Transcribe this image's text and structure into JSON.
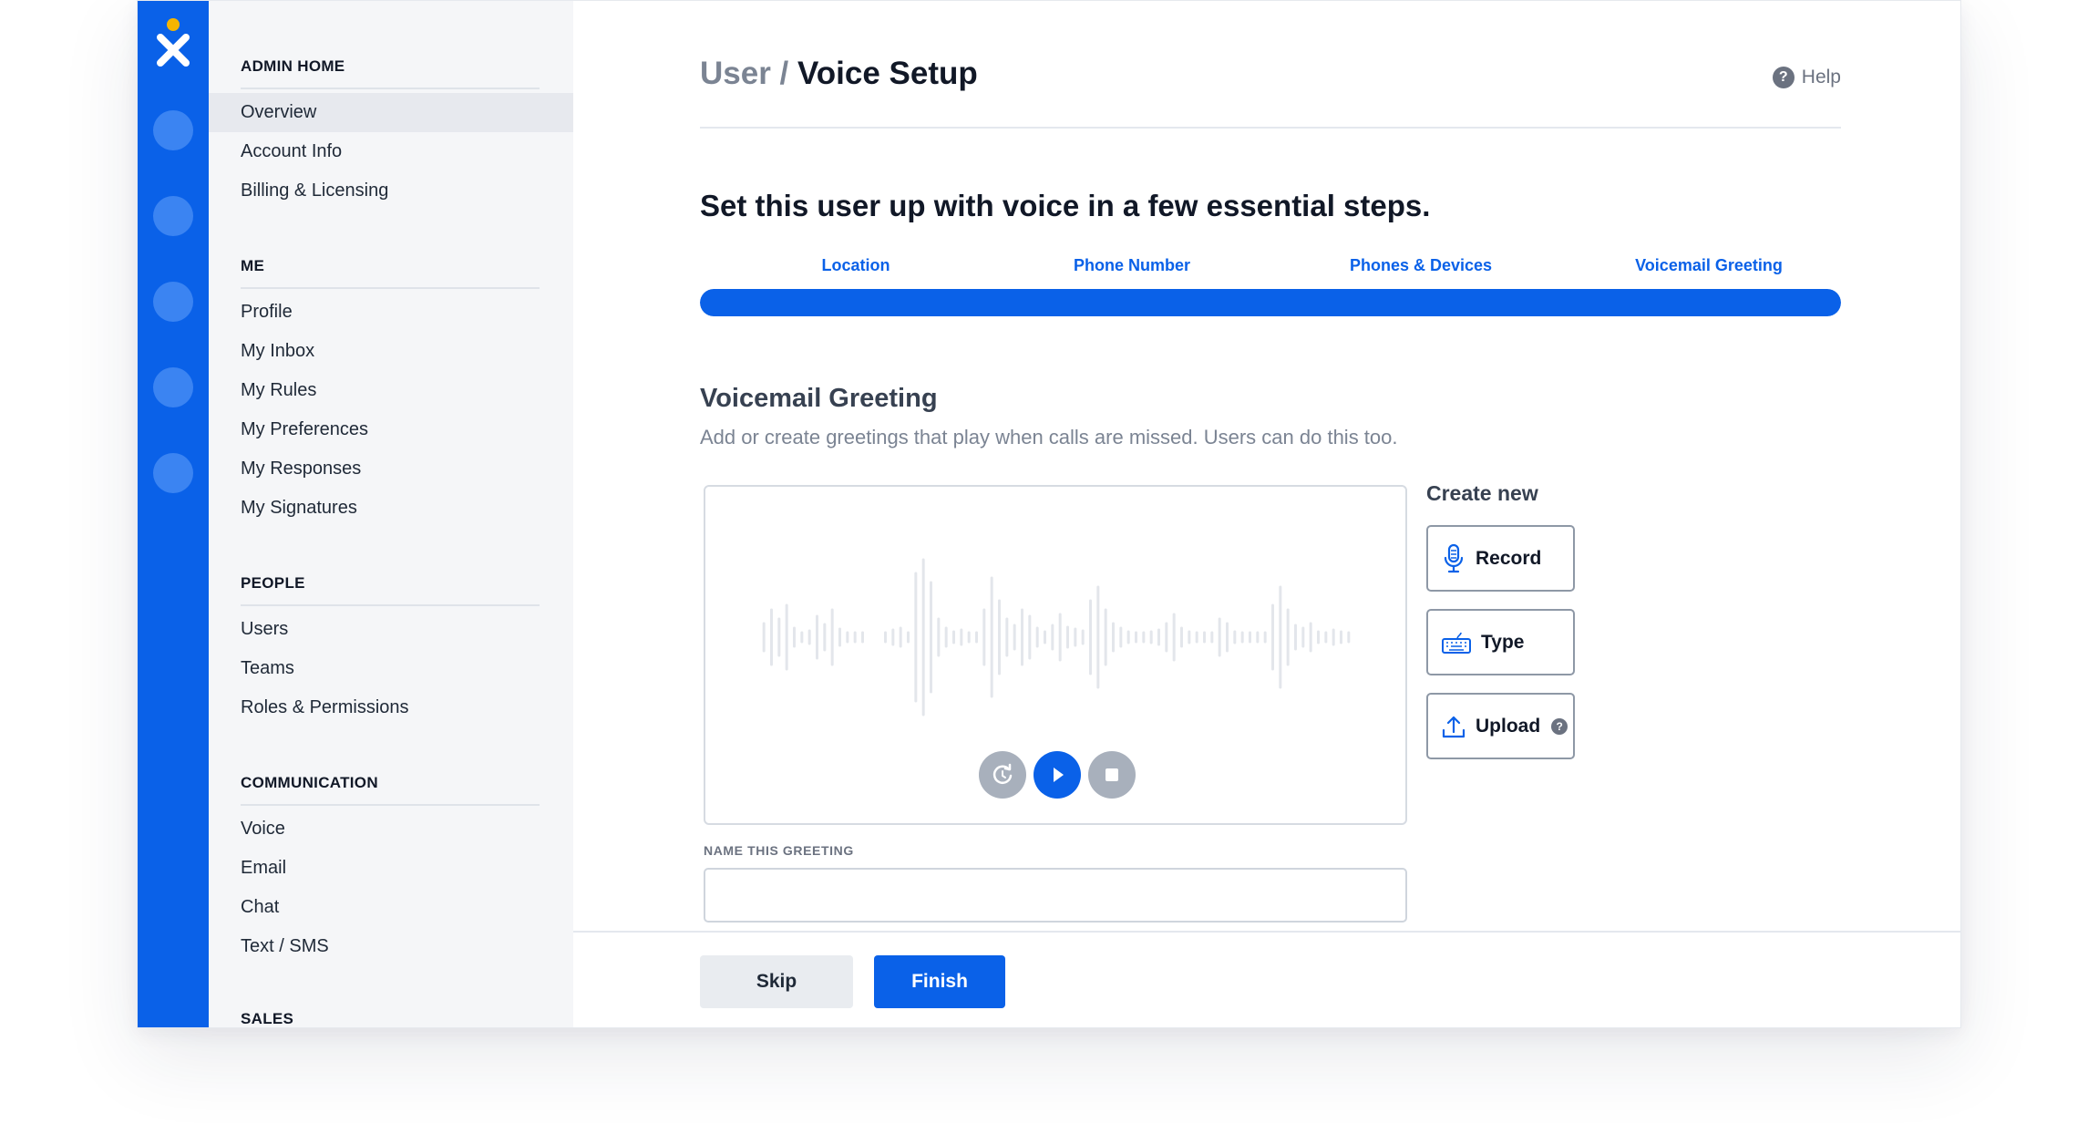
{
  "sidebar": {
    "sections": [
      {
        "title": "ADMIN HOME",
        "items": [
          "Overview",
          "Account Info",
          "Billing & Licensing"
        ]
      },
      {
        "title": "ME",
        "items": [
          "Profile",
          "My Inbox",
          "My Rules",
          "My Preferences",
          "My Responses",
          "My Signatures"
        ]
      },
      {
        "title": "PEOPLE",
        "items": [
          "Users",
          "Teams",
          "Roles & Permissions"
        ]
      },
      {
        "title": "COMMUNICATION",
        "items": [
          "Voice",
          "Email",
          "Chat",
          "Text / SMS"
        ]
      },
      {
        "title": "SALES",
        "items": []
      }
    ],
    "active_item": "Overview"
  },
  "header": {
    "breadcrumb": "User /",
    "title": "Voice Setup",
    "help_label": "Help"
  },
  "intro": "Set this user up with voice in a few essential steps.",
  "steps": [
    "Location",
    "Phone Number",
    "Phones & Devices",
    "Voicemail Greeting"
  ],
  "progress_fraction": 1.0,
  "section": {
    "title": "Voicemail Greeting",
    "description": "Add or create greetings that play when calls are missed. Users can do this too."
  },
  "greeting_name": {
    "label": "NAME THIS GREETING",
    "value": ""
  },
  "create_new": {
    "label": "Create new",
    "buttons": [
      "Record",
      "Type",
      "Upload"
    ]
  },
  "footer": {
    "skip_label": "Skip",
    "finish_label": "Finish"
  },
  "colors": {
    "brand_blue": "#0a61e8",
    "rail_dot": "#3b84f2",
    "logo_dot": "#f6b500",
    "control_grey": "#a8b0bc"
  }
}
